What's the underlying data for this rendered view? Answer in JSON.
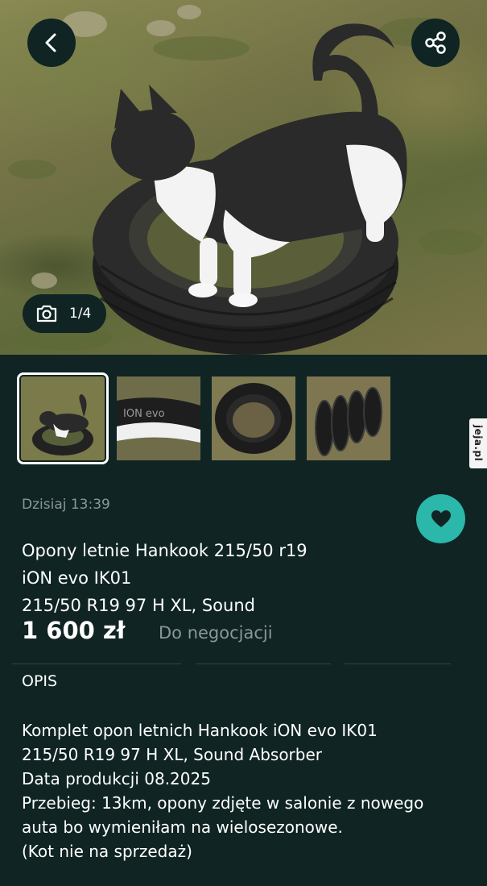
{
  "app": {
    "bg_color": "#0f2423",
    "accent_color": "#2bb7a9"
  },
  "gallery": {
    "counter": "1/4",
    "thumbnails": [
      {
        "subject": "cat standing on tire",
        "selected": true
      },
      {
        "subject": "tire sidewall with ION evo text",
        "selected": false,
        "text": "ION evo"
      },
      {
        "subject": "single tire lying flat",
        "selected": false
      },
      {
        "subject": "four tires stacked in a row",
        "selected": false
      }
    ],
    "icons": {
      "back": "chevron-left-icon",
      "share": "share-icon",
      "camera": "camera-icon"
    }
  },
  "watermark": {
    "text": "jeja.pl"
  },
  "listing": {
    "date": "Dzisiaj 13:39",
    "title_lines": [
      "Opony letnie Hankook 215/50 r19",
      "iON evo IK01",
      "215/50 R19 97 H XL, Sound"
    ],
    "price": "1 600 zł",
    "negotiable": "Do negocjacji",
    "favorite_icon": "heart-icon"
  },
  "description": {
    "title": "OPIS",
    "lines": [
      "Komplet opon letnich Hankook iON evo IK01",
      "215/50 R19 97 H XL, Sound Absorber",
      "Data produkcji 08.2025",
      "Przebieg: 13km, opony zdjęte w salonie z nowego",
      "auta bo wymieniłam na wielosezonowe.",
      "(Kot nie na sprzedaż)"
    ]
  }
}
